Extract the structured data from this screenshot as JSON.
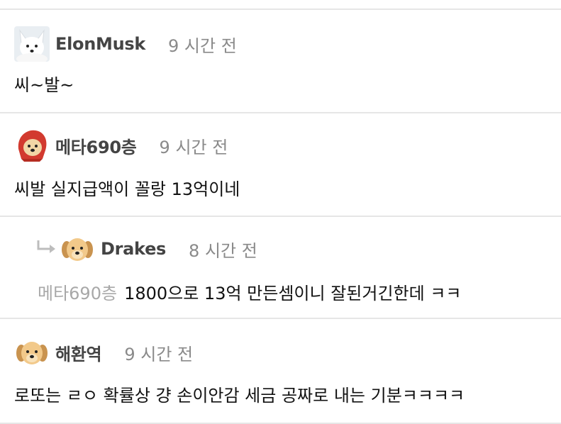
{
  "comments": [
    {
      "author": "ElonMusk",
      "time": "9 시간 전",
      "avatar_icon": "arctic-fox-avatar",
      "text": "씨~발~"
    },
    {
      "author": "메타690층",
      "time": "9 시간 전",
      "avatar_icon": "red-hood-dog-avatar",
      "text": "씨발 실지급액이 꼴랑 13억이네"
    },
    {
      "author": "Drakes",
      "time": "8 시간 전",
      "avatar_icon": "golden-puppy-avatar",
      "is_reply": true,
      "reply_icon": "reply-arrow-icon",
      "mention": "메타690층",
      "text": "1800으로 13억 만든셈이니 잘된거긴한데 ㅋㅋ"
    },
    {
      "author": "해환역",
      "time": "9 시간 전",
      "avatar_icon": "golden-puppy-avatar",
      "text": "로또는 ㄹㅇ 확률상 걍 손이안감 세금 공짜로 내는 기분ㅋㅋㅋㅋ"
    }
  ],
  "colors": {
    "author": "#444444",
    "time": "#8a8a8a",
    "mention": "#a8a8a8",
    "divider": "#e6e6e6"
  }
}
